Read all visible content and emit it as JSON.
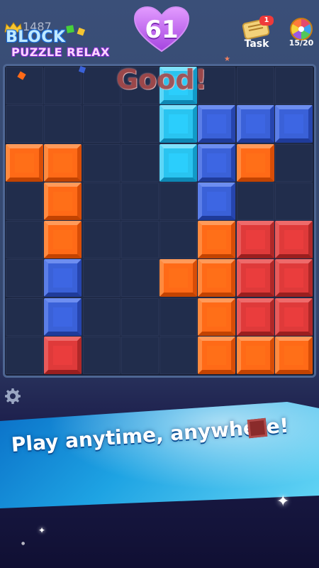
{
  "header": {
    "logo_line1": "BLOCK",
    "logo_line2": "PUZZLE RELAX",
    "best_score": "1487",
    "score": "61",
    "task_label": "Task",
    "task_badge": "1",
    "spin_progress": "15/20"
  },
  "board": {
    "rows": 8,
    "cols": 8,
    "tiles": [
      {
        "r": 0,
        "c": 4,
        "color": "cyan"
      },
      {
        "r": 1,
        "c": 4,
        "color": "cyan"
      },
      {
        "r": 1,
        "c": 5,
        "color": "blue"
      },
      {
        "r": 1,
        "c": 6,
        "color": "blue"
      },
      {
        "r": 1,
        "c": 7,
        "color": "blue"
      },
      {
        "r": 2,
        "c": 0,
        "color": "orange"
      },
      {
        "r": 2,
        "c": 1,
        "color": "orange"
      },
      {
        "r": 2,
        "c": 4,
        "color": "cyan"
      },
      {
        "r": 2,
        "c": 5,
        "color": "blue"
      },
      {
        "r": 2,
        "c": 6,
        "color": "orange"
      },
      {
        "r": 3,
        "c": 1,
        "color": "orange"
      },
      {
        "r": 3,
        "c": 5,
        "color": "blue"
      },
      {
        "r": 4,
        "c": 1,
        "color": "orange"
      },
      {
        "r": 4,
        "c": 5,
        "color": "orange"
      },
      {
        "r": 4,
        "c": 6,
        "color": "red"
      },
      {
        "r": 4,
        "c": 7,
        "color": "red"
      },
      {
        "r": 5,
        "c": 1,
        "color": "blue"
      },
      {
        "r": 5,
        "c": 4,
        "color": "orange"
      },
      {
        "r": 5,
        "c": 5,
        "color": "orange"
      },
      {
        "r": 5,
        "c": 6,
        "color": "red"
      },
      {
        "r": 5,
        "c": 7,
        "color": "red"
      },
      {
        "r": 6,
        "c": 1,
        "color": "blue"
      },
      {
        "r": 6,
        "c": 5,
        "color": "orange"
      },
      {
        "r": 6,
        "c": 6,
        "color": "red"
      },
      {
        "r": 6,
        "c": 7,
        "color": "red"
      },
      {
        "r": 7,
        "c": 1,
        "color": "red"
      },
      {
        "r": 7,
        "c": 5,
        "color": "orange"
      },
      {
        "r": 7,
        "c": 6,
        "color": "orange"
      },
      {
        "r": 7,
        "c": 7,
        "color": "orange"
      }
    ]
  },
  "feedback_text": "Good!",
  "banner_text": "Play anytime, anywhere!",
  "colors": {
    "orange": "#ff6a17",
    "red": "#df3a3a",
    "blue": "#3a61d8",
    "cyan": "#29c4f0",
    "heart": "#c064f0"
  },
  "icons": [
    "crown-icon",
    "heart-icon",
    "task-scroll-icon",
    "spin-wheel-icon",
    "settings-gear-icon",
    "sparkle-icon"
  ]
}
